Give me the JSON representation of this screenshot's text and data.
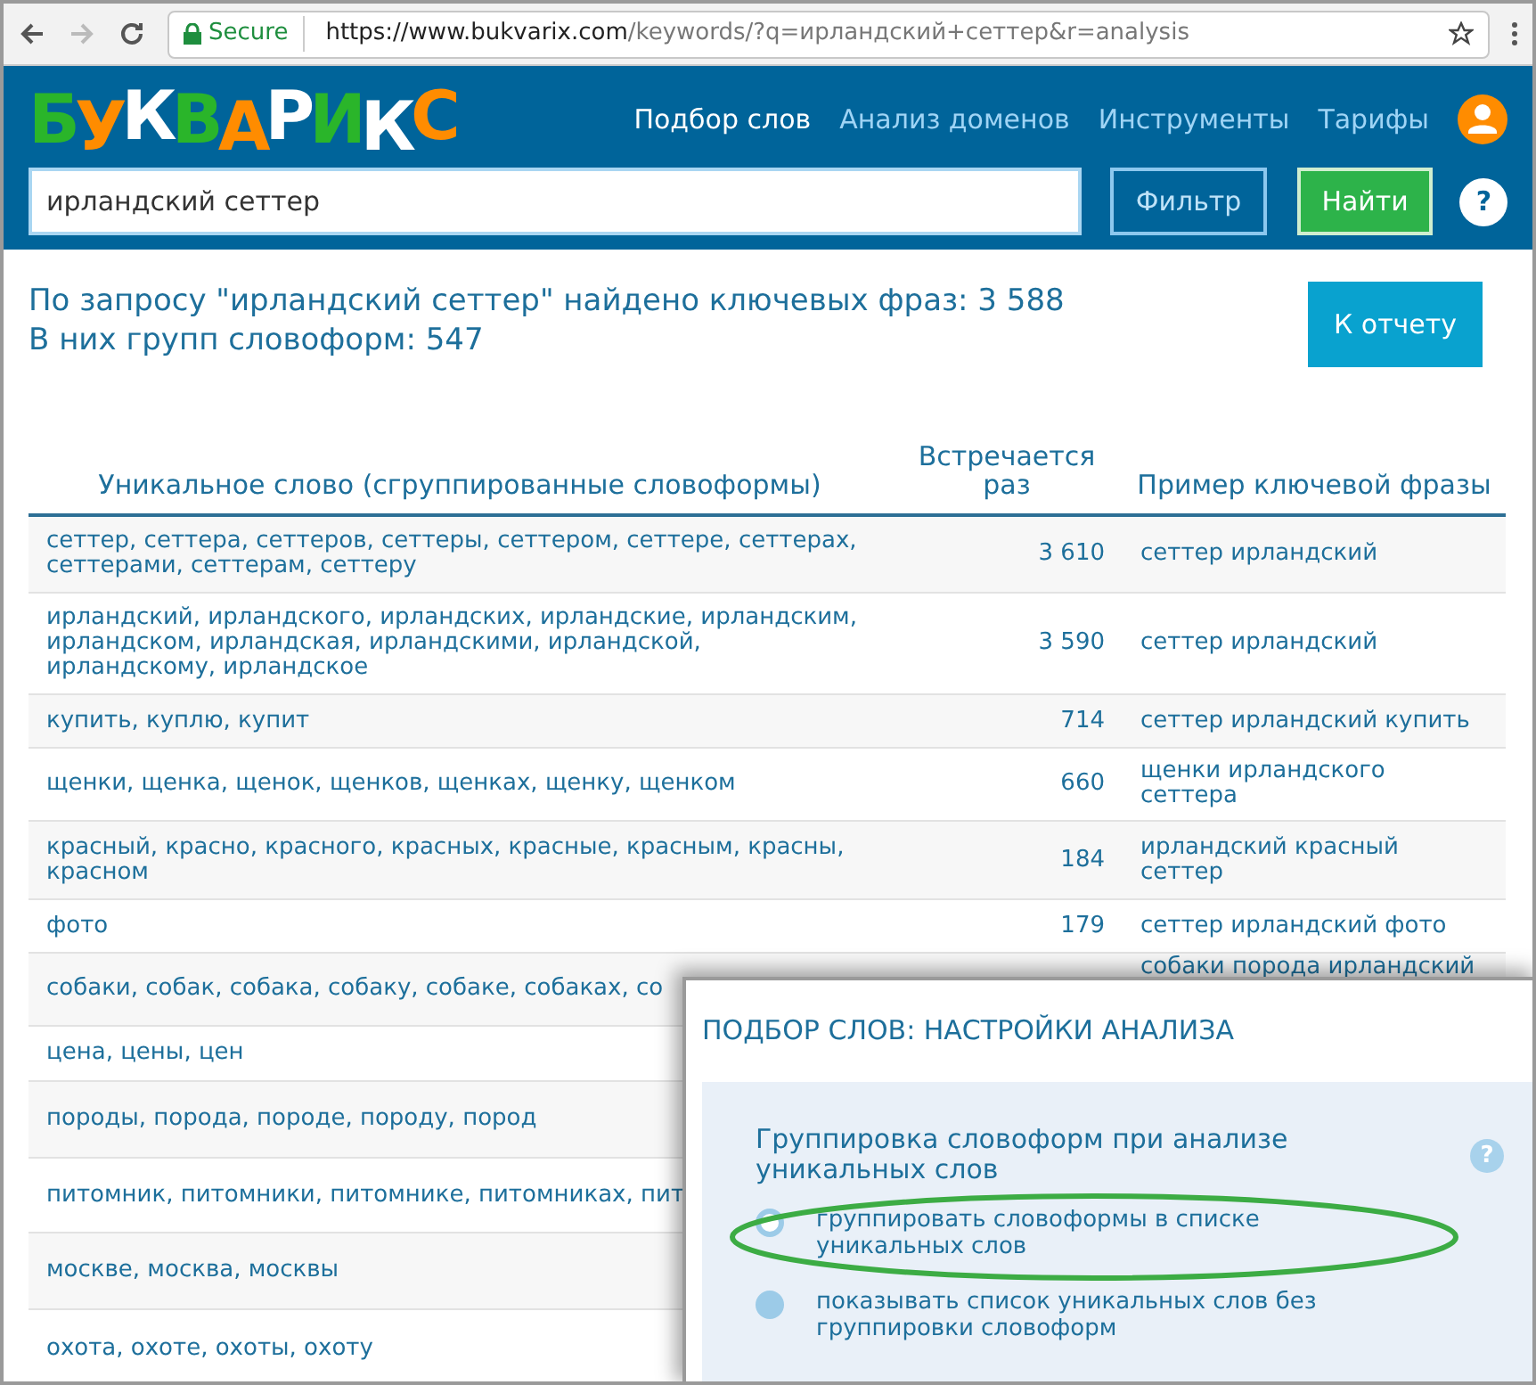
{
  "browser": {
    "secure_label": "Secure",
    "url_host": "https://www.bukvarix.com",
    "url_path": "/keywords/?q=ирландский+сеттер&r=analysis"
  },
  "header": {
    "logo": [
      {
        "letter": "Б",
        "color": "#2ab52a"
      },
      {
        "letter": "У",
        "color": "#ff8c00"
      },
      {
        "letter": "К",
        "color": "#ffffff"
      },
      {
        "letter": "В",
        "color": "#2ab52a"
      },
      {
        "letter": "А",
        "color": "#ff8c00"
      },
      {
        "letter": "Р",
        "color": "#ffffff"
      },
      {
        "letter": "И",
        "color": "#2ab52a"
      },
      {
        "letter": "К",
        "color": "#ffffff"
      },
      {
        "letter": "С",
        "color": "#ff8c00"
      }
    ],
    "nav": [
      {
        "label": "Подбор слов",
        "selected": true
      },
      {
        "label": "Анализ доменов",
        "selected": false
      },
      {
        "label": "Инструменты",
        "selected": false
      },
      {
        "label": "Тарифы",
        "selected": false
      }
    ],
    "search": {
      "value": "ирландский сеттер"
    },
    "filter_button": "Фильтр",
    "find_button": "Найти",
    "help_button": "?"
  },
  "summary": {
    "line_1": "По запросу \"ирландский сеттер\" найдено ключевых фраз: 3 588",
    "line_2": "В них групп словоформ: 547",
    "report_button": "К отчету"
  },
  "table": {
    "columns": [
      "Уникальное слово (сгруппированные словоформы)",
      "Встречается раз",
      "Пример ключевой фразы"
    ],
    "rows": [
      {
        "words": "сеттер, сеттера, сеттеров, сеттеры, сеттером, сеттере, сеттерах, сеттерами, сеттерам, сеттеру",
        "count": "3 610",
        "example": "сеттер ирландский"
      },
      {
        "words": "ирландский, ирландского, ирландских, ирландские, ирландским, ирландском, ирландская, ирландскими, ирландской, ирландскому, ирландское",
        "count": "3 590",
        "example": "сеттер ирландский"
      },
      {
        "words": "купить, куплю, купит",
        "count": "714",
        "example": "сеттер ирландский купить"
      },
      {
        "words": "щенки, щенка, щенок, щенков, щенках, щенку, щенком",
        "count": "660",
        "example": "щенки ирландского сеттера"
      },
      {
        "words": "красный, красно, красного, красных, красные, красным, красны, красном",
        "count": "184",
        "example": "ирландский красный сеттер"
      },
      {
        "words": "фото",
        "count": "179",
        "example": "сеттер ирландский фото"
      },
      {
        "words": "собаки, собак, собака, собаку, собаке, собаках, со",
        "example": "собаки порода ирландский"
      },
      {
        "words": "цена, цены, цен"
      },
      {
        "words": "породы, порода, породе, породу, пород"
      },
      {
        "words": "питомник, питомники, питомнике, питомниках, пит"
      },
      {
        "words": "москве, москва, москвы"
      },
      {
        "words": "охота, охоте, охоты, охоту"
      }
    ]
  },
  "dialog": {
    "title": "ПОДБОР СЛОВ: НАСТРОЙКИ АНАЛИЗА",
    "group_label": "Группировка словоформ при анализе уникальных слов",
    "help": "?",
    "options": [
      {
        "label": "группировать словоформы в списке уникальных слов",
        "selected": true
      },
      {
        "label": "показывать список уникальных слов без группировки словоформ",
        "selected": false
      }
    ]
  }
}
